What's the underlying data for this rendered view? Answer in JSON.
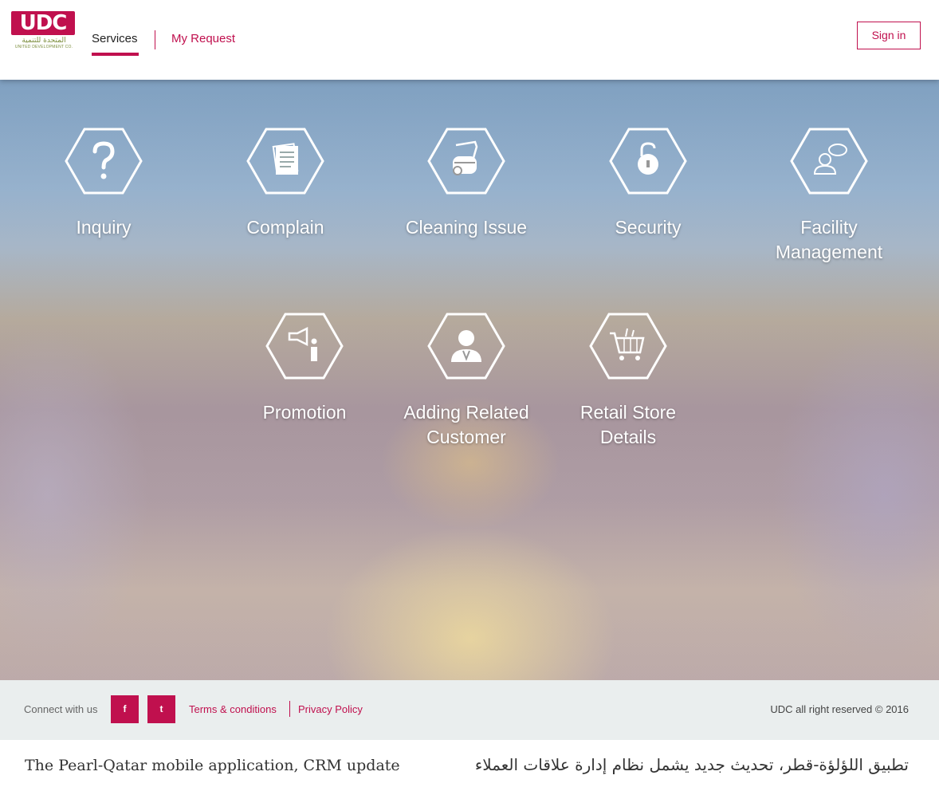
{
  "header": {
    "logo_text": "UDC",
    "logo_arabic": "المتحدة للتنمية",
    "logo_english": "UNITED DEVELOPMENT CO.",
    "nav": [
      {
        "label": "Services",
        "active": true
      },
      {
        "label": "My Request",
        "active": false
      }
    ],
    "signin_label": "Sign in"
  },
  "services": [
    {
      "label": "Inquiry",
      "icon": "question-icon"
    },
    {
      "label": "Complain",
      "icon": "documents-icon"
    },
    {
      "label": "Cleaning Issue",
      "icon": "vacuum-cleaner-icon"
    },
    {
      "label": "Security",
      "icon": "padlock-icon"
    },
    {
      "label": "Facility\nManagement",
      "icon": "support-agent-icon"
    },
    {
      "label": "Promotion",
      "icon": "megaphone-icon"
    },
    {
      "label": "Adding Related\nCustomer",
      "icon": "customer-icon"
    },
    {
      "label": "Retail Store\nDetails",
      "icon": "shopping-cart-icon"
    }
  ],
  "footer": {
    "connect_label": "Connect with us",
    "facebook_glyph": "f",
    "twitter_glyph": "t",
    "terms_label": "Terms & conditions",
    "privacy_label": "Privacy Policy",
    "copyright": "UDC all right reserved © 2016"
  },
  "caption": {
    "english": "The Pearl-Qatar mobile application, CRM update",
    "arabic": "تطبيق اللؤلؤة-قطر، تحديث جديد يشمل نظام إدارة علاقات العملاء"
  },
  "colors": {
    "brand": "#c0104e",
    "footer_bg": "#eaeeee"
  }
}
